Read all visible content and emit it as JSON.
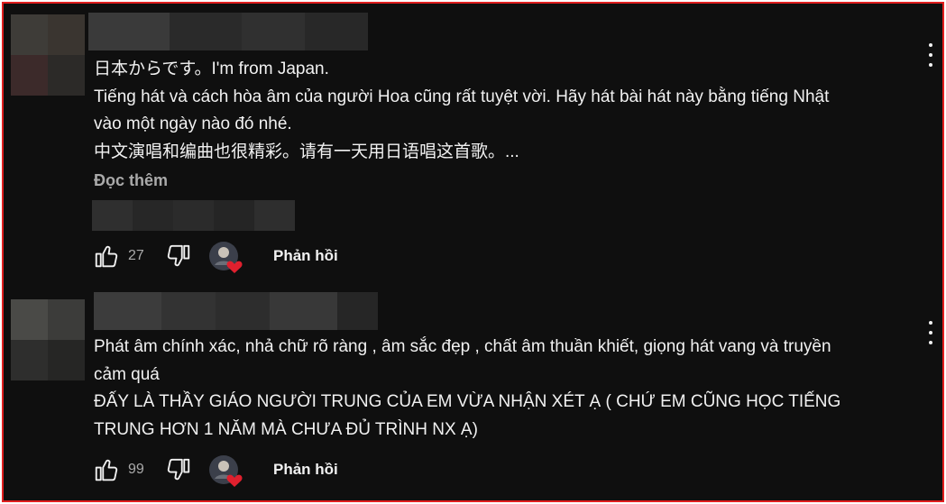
{
  "colors": {
    "frame_border": "#e01f1f",
    "background": "#0f0f0f",
    "text_primary": "#f1f1f1",
    "text_secondary": "#aaaaaa",
    "heart": "#e0202e"
  },
  "comments": [
    {
      "lines": [
        "日本からです。I'm from Japan.",
        "Tiếng hát và cách hòa âm của người Hoa cũng rất tuyệt vời. Hãy hát bài hát này bằng tiếng Nhật",
        "vào một ngày nào đó nhé.",
        "中文演唱和编曲也很精彩。请有一天用日语唱这首歌。..."
      ],
      "read_more": "Đọc thêm",
      "like_icon": "thumb-up-icon",
      "like_count": "27",
      "dislike_icon": "thumb-down-icon",
      "creator_heart_icon": "heart-icon",
      "reply_label": "Phản hồi",
      "menu_icon": "more-vert-icon"
    },
    {
      "lines": [
        "Phát âm chính xác, nhả chữ rõ ràng , âm sắc đẹp , chất âm thuần khiết, giọng hát vang và truyền",
        "cảm quá",
        "ĐẤY LÀ THẦY GIÁO NGƯỜI TRUNG CỦA EM VỪA NHẬN XÉT Ạ ( CHỨ EM CŨNG HỌC TIẾNG",
        "TRUNG HƠN 1 NĂM MÀ CHƯA ĐỦ TRÌNH NX Ạ)"
      ],
      "like_icon": "thumb-up-icon",
      "like_count": "99",
      "dislike_icon": "thumb-down-icon",
      "creator_heart_icon": "heart-icon",
      "reply_label": "Phản hồi",
      "menu_icon": "more-vert-icon"
    }
  ]
}
